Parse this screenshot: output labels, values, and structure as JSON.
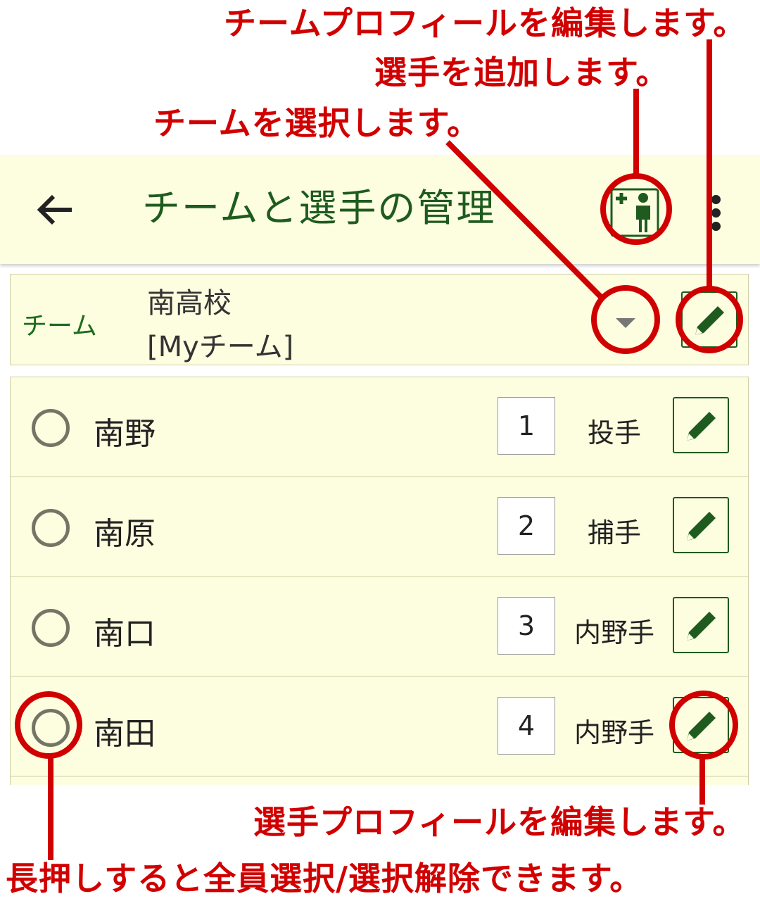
{
  "callouts": {
    "edit_team_profile": "チームプロフィールを編集します。",
    "add_player": "選手を追加します。",
    "select_team": "チームを選択します。",
    "edit_player_profile": "選手プロフィールを編集します。",
    "long_press": "長押しすると全員選択/選択解除できます。"
  },
  "appbar": {
    "title": "チームと選手の管理",
    "back_icon": "arrow-left",
    "add_player_icon": "add-person",
    "more_icon": "more-vert"
  },
  "team": {
    "label": "チーム",
    "name_line1": "南高校",
    "name_line2": "[Myチーム]"
  },
  "players": [
    {
      "name": "南野",
      "number": "1",
      "position": "投手"
    },
    {
      "name": "南原",
      "number": "2",
      "position": "捕手"
    },
    {
      "name": "南口",
      "number": "3",
      "position": "内野手"
    },
    {
      "name": "南田",
      "number": "4",
      "position": "内野手"
    }
  ],
  "colors": {
    "accent_green": "#1e5b1e",
    "callout_red": "#d10000",
    "surface": "#fdfde0"
  }
}
